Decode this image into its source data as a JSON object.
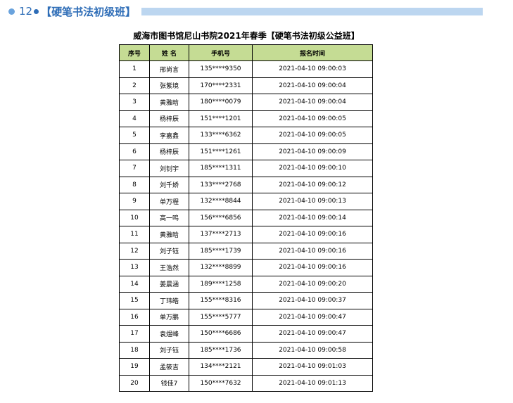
{
  "heading": {
    "number": "12",
    "text": "【硬笔书法初级班】"
  },
  "title": "威海市图书馆尼山书院2021年春季【硬笔书法初级公益班】",
  "table": {
    "headers": [
      "序号",
      "姓 名",
      "手机号",
      "报名时间"
    ],
    "rows": [
      [
        "1",
        "邢尚言",
        "135****9350",
        "2021-04-10 09:00:03"
      ],
      [
        "2",
        "张紫境",
        "170****2331",
        "2021-04-10 09:00:04"
      ],
      [
        "3",
        "黄雅晗",
        "180****0079",
        "2021-04-10 09:00:04"
      ],
      [
        "4",
        "杨梓辰",
        "151****1201",
        "2021-04-10 09:00:05"
      ],
      [
        "5",
        "李嘉鑫",
        "133****6362",
        "2021-04-10 09:00:05"
      ],
      [
        "6",
        "杨梓辰",
        "151****1261",
        "2021-04-10 09:00:09"
      ],
      [
        "7",
        "刘钊宇",
        "185****1311",
        "2021-04-10 09:00:10"
      ],
      [
        "8",
        "刘千娇",
        "133****2768",
        "2021-04-10 09:00:12"
      ],
      [
        "9",
        "单万程",
        "132****8844",
        "2021-04-10 09:00:13"
      ],
      [
        "10",
        "高一鸣",
        "156****6856",
        "2021-04-10 09:00:14"
      ],
      [
        "11",
        "黄雅晗",
        "137****2713",
        "2021-04-10 09:00:16"
      ],
      [
        "12",
        "刘子钰",
        "185****1739",
        "2021-04-10 09:00:16"
      ],
      [
        "13",
        "王浩然",
        "132****8899",
        "2021-04-10 09:00:16"
      ],
      [
        "14",
        "姜晨涵",
        "189****1258",
        "2021-04-10 09:00:20"
      ],
      [
        "15",
        "丁玮皓",
        "155****8316",
        "2021-04-10 09:00:37"
      ],
      [
        "16",
        "单万鹏",
        "155****5777",
        "2021-04-10 09:00:47"
      ],
      [
        "17",
        "袁煜峰",
        "150****6686",
        "2021-04-10 09:00:47"
      ],
      [
        "18",
        "刘子钰",
        "185****1736",
        "2021-04-10 09:00:58"
      ],
      [
        "19",
        "孟筱吉",
        "134****2121",
        "2021-04-10 09:01:03"
      ],
      [
        "20",
        "钱佳7",
        "150****7632",
        "2021-04-10 09:01:13"
      ]
    ]
  },
  "colors": {
    "accent": "#2e6db7",
    "header_fill": "#c5dc94",
    "stripe": "#bcd6f0"
  }
}
